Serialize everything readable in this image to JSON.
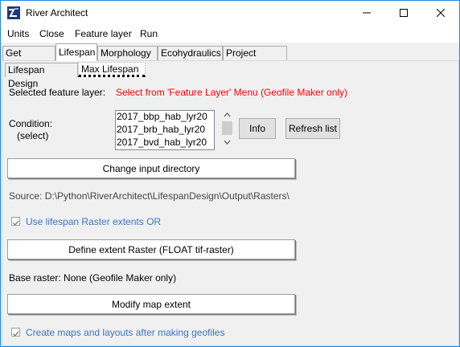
{
  "window": {
    "title": "River Architect"
  },
  "menu": [
    "Units",
    "Close",
    "Feature layer",
    "Run"
  ],
  "tabs": [
    "Get Started",
    "Lifespan",
    "Morphology",
    "Ecohydraulics",
    "Project Maker"
  ],
  "subtabs": [
    "Lifespan Design",
    "Max Lifespan"
  ],
  "feature": {
    "label": "Selected feature layer:",
    "value": "Select from 'Feature Layer' Menu (Geofile Maker only)"
  },
  "condition": {
    "label": "Condition:",
    "sublabel": "(select)",
    "items": [
      "2017_bbp_hab_lyr20",
      "2017_brb_hab_lyr20",
      "2017_bvd_hab_lyr20"
    ]
  },
  "buttons": {
    "info": "Info",
    "refresh": "Refresh list",
    "change_dir": "Change input directory",
    "define_extent": "Define extent Raster (FLOAT tif-raster)",
    "modify_extent": "Modify map extent"
  },
  "source": "Source: D:\\Python\\RiverArchitect\\LifespanDesign\\Output\\Rasters\\",
  "checkbox_lifespan": {
    "label": "Use lifespan Raster extents OR",
    "checked": true
  },
  "base_raster": "Base raster: None (Geofile Maker only)",
  "checkbox_maps": {
    "label": "Create maps and layouts after making geofiles",
    "checked": true
  }
}
